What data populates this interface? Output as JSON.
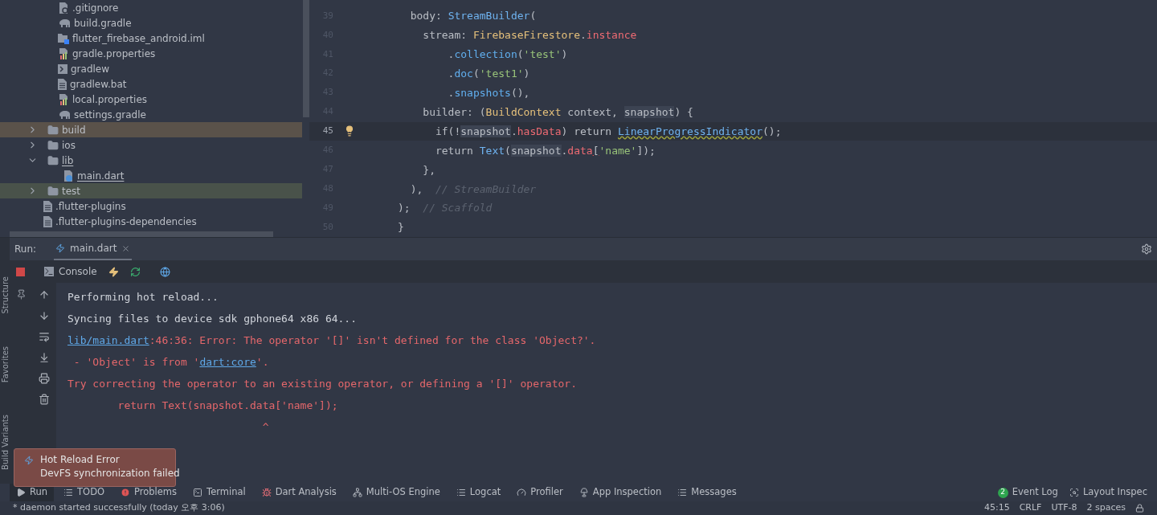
{
  "project_tree": {
    "scrolled_parent_children": [
      {
        "name": ".gitignore",
        "kind": "ignore"
      },
      {
        "name": "build.gradle",
        "kind": "gradle"
      },
      {
        "name": "flutter_firebase_android.iml",
        "kind": "module"
      },
      {
        "name": "gradle.properties",
        "kind": "properties"
      },
      {
        "name": "gradlew",
        "kind": "script"
      },
      {
        "name": "gradlew.bat",
        "kind": "text"
      },
      {
        "name": "local.properties",
        "kind": "properties"
      },
      {
        "name": "settings.gradle",
        "kind": "gradle"
      }
    ],
    "items": [
      {
        "name": "build",
        "kind": "folder",
        "expanded": false,
        "color": "#5a524a"
      },
      {
        "name": "ios",
        "kind": "folder",
        "expanded": false
      },
      {
        "name": "lib",
        "kind": "folder",
        "expanded": true,
        "current": true,
        "children": [
          {
            "name": "main.dart",
            "kind": "dart",
            "current": true
          }
        ]
      },
      {
        "name": "test",
        "kind": "folder",
        "expanded": false,
        "color": "#49524a"
      },
      {
        "name": ".flutter-plugins",
        "kind": "text"
      },
      {
        "name": ".flutter-plugins-dependencies",
        "kind": "text"
      }
    ]
  },
  "editor": {
    "lines": [
      {
        "number": "39",
        "current": false,
        "tokens": [
          {
            "t": "  body: ",
            "kind": "plain"
          },
          {
            "t": "StreamBuilder",
            "kind": "class"
          },
          {
            "t": "(",
            "kind": "plain"
          }
        ]
      },
      {
        "number": "40",
        "current": false,
        "tokens": [
          {
            "t": "    stream: ",
            "kind": "plain"
          },
          {
            "t": "FirebaseFirestore",
            "kind": "type"
          },
          {
            "t": ".",
            "kind": "plain"
          },
          {
            "t": "instance",
            "kind": "field"
          }
        ]
      },
      {
        "number": "41",
        "current": false,
        "tokens": [
          {
            "t": "        .",
            "kind": "plain"
          },
          {
            "t": "collection",
            "kind": "method"
          },
          {
            "t": "(",
            "kind": "plain"
          },
          {
            "t": "'test'",
            "kind": "string"
          },
          {
            "t": ")",
            "kind": "plain"
          }
        ]
      },
      {
        "number": "42",
        "current": false,
        "tokens": [
          {
            "t": "        .",
            "kind": "plain"
          },
          {
            "t": "doc",
            "kind": "method"
          },
          {
            "t": "(",
            "kind": "plain"
          },
          {
            "t": "'test1'",
            "kind": "string"
          },
          {
            "t": ")",
            "kind": "plain"
          }
        ]
      },
      {
        "number": "43",
        "current": false,
        "tokens": [
          {
            "t": "        .",
            "kind": "plain"
          },
          {
            "t": "snapshots",
            "kind": "method"
          },
          {
            "t": "(),",
            "kind": "plain"
          }
        ]
      },
      {
        "number": "44",
        "current": false,
        "tokens": [
          {
            "t": "    builder: (",
            "kind": "plain"
          },
          {
            "t": "BuildContext",
            "kind": "type"
          },
          {
            "t": " context, ",
            "kind": "plain"
          },
          {
            "t": "snapshot",
            "kind": "ref"
          },
          {
            "t": ") {",
            "kind": "plain"
          }
        ]
      },
      {
        "number": "45",
        "current": true,
        "tokens": [
          {
            "t": "      if(!",
            "kind": "plain"
          },
          {
            "t": "snapshot",
            "kind": "ref"
          },
          {
            "t": ".",
            "kind": "plain"
          },
          {
            "t": "hasData",
            "kind": "field"
          },
          {
            "t": ") return ",
            "kind": "plain"
          },
          {
            "t": "LinearProgressIndicator",
            "kind": "warn"
          },
          {
            "t": "();",
            "kind": "plain"
          }
        ]
      },
      {
        "number": "46",
        "current": false,
        "tokens": [
          {
            "t": "      return ",
            "kind": "plain"
          },
          {
            "t": "Text",
            "kind": "class"
          },
          {
            "t": "(",
            "kind": "plain"
          },
          {
            "t": "snapshot",
            "kind": "ref"
          },
          {
            "t": ".",
            "kind": "plain"
          },
          {
            "t": "data",
            "kind": "field"
          },
          {
            "t": "[",
            "kind": "error"
          },
          {
            "t": "'name'",
            "kind": "string"
          },
          {
            "t": "]);",
            "kind": "plain"
          }
        ]
      },
      {
        "number": "47",
        "current": false,
        "tokens": [
          {
            "t": "    },",
            "kind": "plain"
          }
        ]
      },
      {
        "number": "48",
        "current": false,
        "tokens": [
          {
            "t": "  ),  ",
            "kind": "plain"
          },
          {
            "t": "// StreamBuilder",
            "kind": "comment"
          }
        ]
      },
      {
        "number": "49",
        "current": false,
        "tokens": [
          {
            "t": ");  ",
            "kind": "plain"
          },
          {
            "t": "// Scaffold",
            "kind": "comment"
          }
        ]
      },
      {
        "number": "50",
        "current": false,
        "tokens": [
          {
            "t": "}",
            "kind": "plain"
          }
        ]
      }
    ]
  },
  "run_panel": {
    "label": "Run:",
    "tabs": [
      {
        "label": "main.dart",
        "selected": true
      }
    ],
    "console_tab": "Console",
    "output": [
      {
        "kind": "info",
        "segments": [
          {
            "t": "Performing hot reload...",
            "link": false
          }
        ]
      },
      {
        "kind": "info",
        "segments": [
          {
            "t": "Syncing files to device sdk gphone64 x86 64...",
            "link": false
          }
        ]
      },
      {
        "kind": "error",
        "segments": [
          {
            "t": "lib/main.dart",
            "link": true
          },
          {
            "t": ":46:36: Error: The operator '[]' isn't defined for the class 'Object?'.",
            "link": false
          }
        ]
      },
      {
        "kind": "error",
        "segments": [
          {
            "t": " - 'Object' is from '",
            "link": false
          },
          {
            "t": "dart:core",
            "link": true
          },
          {
            "t": "'.",
            "link": false
          }
        ]
      },
      {
        "kind": "error",
        "segments": [
          {
            "t": "Try correcting the operator to an existing operator, or defining a '[]' operator.",
            "link": false
          }
        ]
      },
      {
        "kind": "error",
        "segments": [
          {
            "t": "        return Text(snapshot.data['name']);",
            "link": false
          }
        ]
      },
      {
        "kind": "error",
        "segments": [
          {
            "t": "                               ^",
            "link": false
          }
        ]
      }
    ]
  },
  "side_labels": [
    "Structure",
    "Favorites",
    "Build Variants"
  ],
  "notification": {
    "title": "Hot Reload Error",
    "message": "DevFS synchronization failed"
  },
  "tool_tabs": [
    {
      "label": "Run",
      "kind": "run",
      "selected": true
    },
    {
      "label": "TODO",
      "kind": "list",
      "selected": false
    },
    {
      "label": "Problems",
      "kind": "problems",
      "selected": false
    },
    {
      "label": "Terminal",
      "kind": "terminal",
      "selected": false
    },
    {
      "label": "Dart Analysis",
      "kind": "analysis",
      "selected": false
    },
    {
      "label": "Multi-OS Engine",
      "kind": "engine",
      "selected": false
    },
    {
      "label": "Logcat",
      "kind": "list",
      "selected": false
    },
    {
      "label": "Profiler",
      "kind": "gauge",
      "selected": false
    },
    {
      "label": "App Inspection",
      "kind": "inspect",
      "selected": false
    },
    {
      "label": "Messages",
      "kind": "list",
      "selected": false
    }
  ],
  "tool_tabs_right": [
    {
      "label": "Event Log",
      "badge": "2",
      "kind": "log"
    },
    {
      "label": "Layout Inspec",
      "kind": "layout"
    }
  ],
  "status_bar": {
    "message": "* daemon started successfully (today 오후 3:06)",
    "items": [
      "45:15",
      "CRLF",
      "UTF-8",
      "2 spaces"
    ]
  }
}
